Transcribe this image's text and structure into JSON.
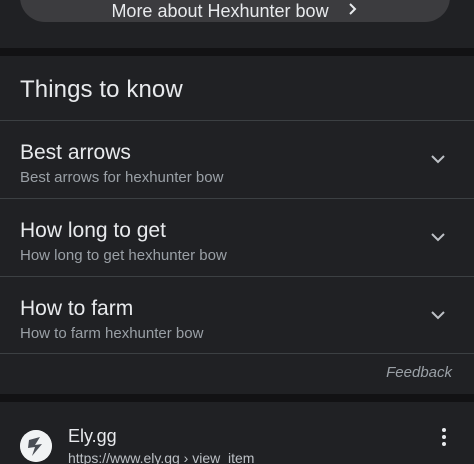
{
  "more_about": {
    "label": "More about Hexhunter bow",
    "chevron_icon": "chevron-right-icon"
  },
  "things_to_know": {
    "title": "Things to know",
    "items": [
      {
        "question": "Best arrows",
        "subtitle": "Best arrows for hexhunter bow",
        "icon": "chevron-down-icon"
      },
      {
        "question": "How long to get",
        "subtitle": "How long to get hexhunter bow",
        "icon": "chevron-down-icon"
      },
      {
        "question": "How to farm",
        "subtitle": "How to farm hexhunter bow",
        "icon": "chevron-down-icon"
      }
    ],
    "feedback": "Feedback"
  },
  "result": {
    "site_name": "Ely.gg",
    "url": "https://www.ely.gg › view_item",
    "site_icon": "ely-gg-logo-icon",
    "menu_icon": "more-vert-icon"
  },
  "colors": {
    "background": "#202124",
    "divider": "#3c4043",
    "primary_text": "#e8eaed",
    "secondary_text": "#9aa0a6",
    "pill": "#3c3c3f"
  }
}
